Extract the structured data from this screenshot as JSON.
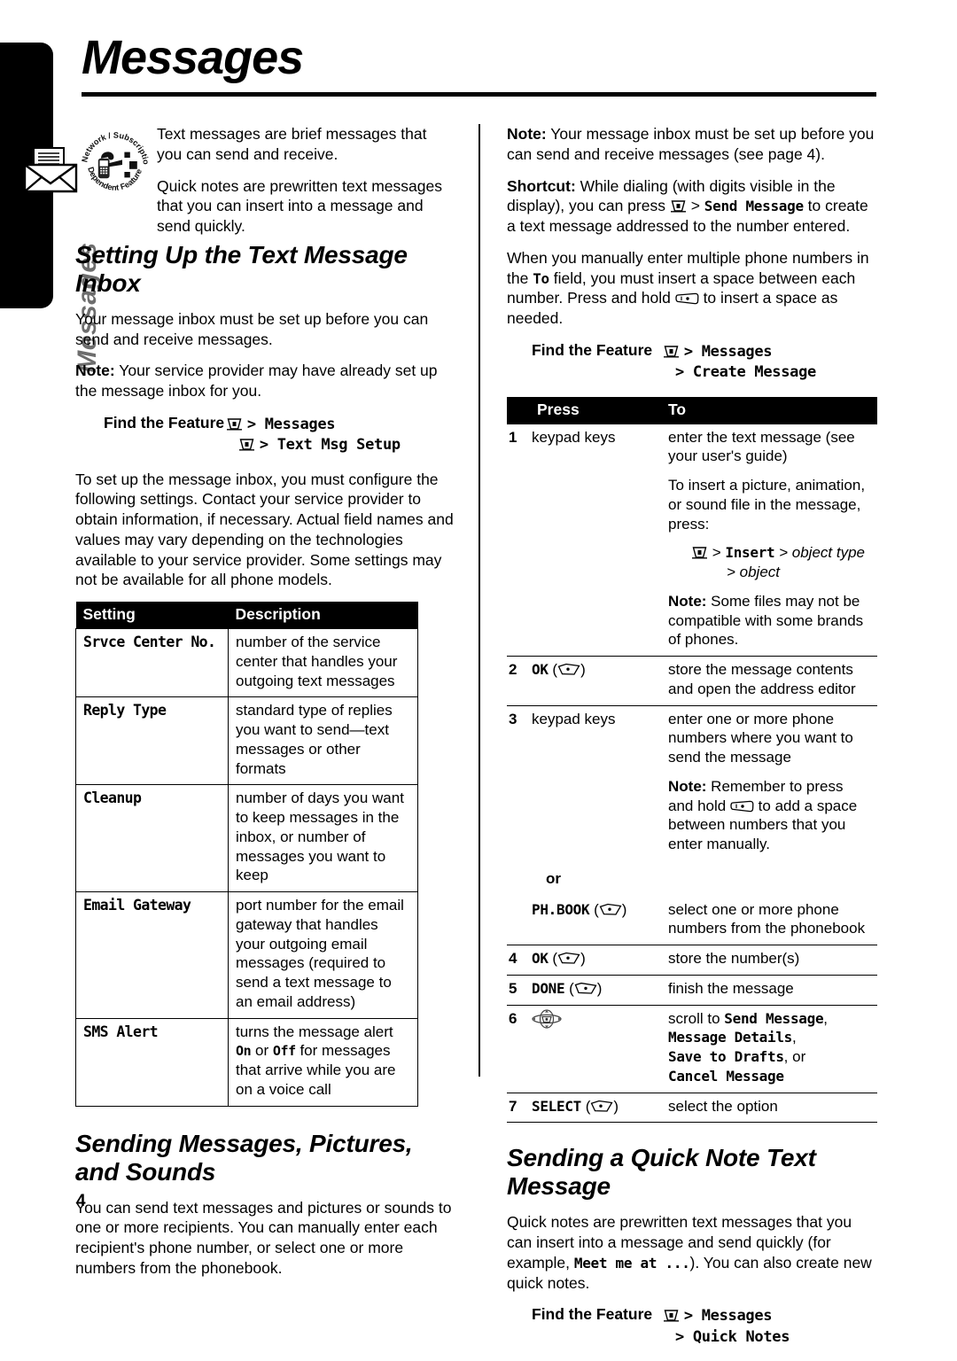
{
  "page": {
    "title": "Messages",
    "side_label": "Messages",
    "page_number": "4",
    "badge_text_top": "Network / Subscription",
    "badge_text_bottom": "Dependent Feature",
    "tab_icon": "message-envelope-icon"
  },
  "glyphs": {
    "menu_key": "menu-key-icon",
    "soft_key": "soft-key-icon",
    "one_key": "one-key-icon",
    "nav_key": "navigation-key-icon"
  },
  "left_column": {
    "intro_1": "Text messages are brief messages that you can send and receive.",
    "intro_2": "Quick notes are prewritten text messages that you can insert into a message and send quickly.",
    "heading_1": "Setting Up the Text Message Inbox",
    "para_1": "Your message inbox must be set up before you can send and receive messages.",
    "note_1_label": "Note:",
    "note_1_text": " Your service provider may have already set up the message inbox for you.",
    "find_feature_label": "Find the Feature",
    "find_feature_line1": "> Messages",
    "find_feature_line2": "> Text Msg Setup",
    "para_2": "To set up the message inbox, you must configure the following settings. Contact your service provider to obtain information, if necessary. Actual field names and values may vary depending on the technologies available to your service provider. Some settings may not be available for all phone models.",
    "settings_table": {
      "headers": [
        "Setting",
        "Description"
      ],
      "rows": [
        {
          "setting": "Srvce Center No.",
          "description": "number of the service center that handles your outgoing text messages"
        },
        {
          "setting": "Reply Type",
          "description": "standard type of replies you want to send—text messages or other formats"
        },
        {
          "setting": "Cleanup",
          "description": "number of days you want to keep messages in the inbox, or number of messages you want to keep"
        },
        {
          "setting": "Email Gateway",
          "description": "port number for the email gateway that handles your outgoing email messages (required to send a text message to an email address)"
        },
        {
          "setting": "SMS Alert",
          "description_pre": "turns the message alert ",
          "description_on": "On",
          "description_mid": " or ",
          "description_off": "Off",
          "description_post": " for messages that arrive while you are on a voice call"
        }
      ]
    },
    "heading_2": "Sending Messages, Pictures, and Sounds",
    "para_3": "You can send text messages and pictures or sounds to one or more recipients. You can manually enter each recipient's phone number, or select one or more numbers from the phonebook."
  },
  "right_column": {
    "note_1_label": "Note:",
    "note_1_text": " Your message inbox must be set up before you can send and receive messages (see page 4).",
    "shortcut_label": "Shortcut:",
    "shortcut_text_1": " While dialing (with digits visible in the display), you can press ",
    "shortcut_gt": " > ",
    "shortcut_menu_item": "Send Message",
    "shortcut_text_2": " to create a text message addressed to the number entered.",
    "para_1_pre": "When you manually enter multiple phone numbers in the ",
    "para_1_to": "To",
    "para_1_mid": " field, you must insert a space between each number. Press and hold ",
    "para_1_post": " to insert a space as needed.",
    "find_feature_label": "Find the Feature",
    "find_feature_line1": "> Messages",
    "find_feature_line2": "> Create Message",
    "steps_table": {
      "headers": [
        "",
        "Press",
        "To"
      ],
      "rows": [
        {
          "num": "1",
          "press": "keypad keys",
          "press_style": "sans",
          "to_blocks": [
            {
              "kind": "text",
              "text": "enter the text message (see your user's guide)"
            },
            {
              "kind": "text",
              "text": "To insert a picture, animation, or sound file in the message, press:"
            },
            {
              "kind": "path",
              "menu": true,
              "text": "> ",
              "bold": "Insert",
              "italic_1": " > object type",
              "italic_2": "> object"
            },
            {
              "kind": "note",
              "label": "Note:",
              "text": " Some files may not be compatible with some brands of phones."
            }
          ]
        },
        {
          "num": "2",
          "press": "OK",
          "press_key": "soft",
          "press_style": "mono",
          "to": "store the message contents and open the address editor"
        },
        {
          "num": "3",
          "press": "keypad keys",
          "press_style": "sans",
          "to_blocks": [
            {
              "kind": "text",
              "text": "enter one or more phone numbers where you want to send the message"
            },
            {
              "kind": "note_key",
              "label": "Note:",
              "text_pre": " Remember to press and hold ",
              "text_post": " to add a space between numbers that you enter manually."
            }
          ]
        },
        {
          "num": "",
          "press": "or",
          "press_style": "or",
          "to": ""
        },
        {
          "num": "",
          "press": "PH.BOOK",
          "press_key": "soft",
          "press_style": "mono",
          "to": "select one or more phone numbers from the phonebook"
        },
        {
          "num": "4",
          "press": "OK",
          "press_key": "soft",
          "press_style": "mono",
          "to": "store the number(s)"
        },
        {
          "num": "5",
          "press": "DONE",
          "press_key": "soft",
          "press_style": "mono",
          "to": "finish the message"
        },
        {
          "num": "6",
          "press": "",
          "press_key": "nav",
          "press_style": "navonly",
          "to_options": {
            "lead": "scroll to ",
            "items": [
              "Send Message",
              "Message Details",
              "Save to Drafts",
              "Cancel Message"
            ],
            "sep1": ",",
            "sep2": ",",
            "sep3": ", or"
          }
        },
        {
          "num": "7",
          "press": "SELECT",
          "press_key": "soft",
          "press_style": "mono",
          "to": "select the option"
        }
      ]
    },
    "heading_1": "Sending a Quick Note Text Message",
    "para_2_pre": "Quick notes are prewritten text messages that you can insert into a message and send quickly (for example, ",
    "para_2_mono": "Meet me at ...",
    "para_2_post": "). You can also create new quick notes.",
    "find_feature_2_label": "Find the Feature",
    "find_feature_2_line1": "> Messages",
    "find_feature_2_line2": "> Quick Notes"
  }
}
